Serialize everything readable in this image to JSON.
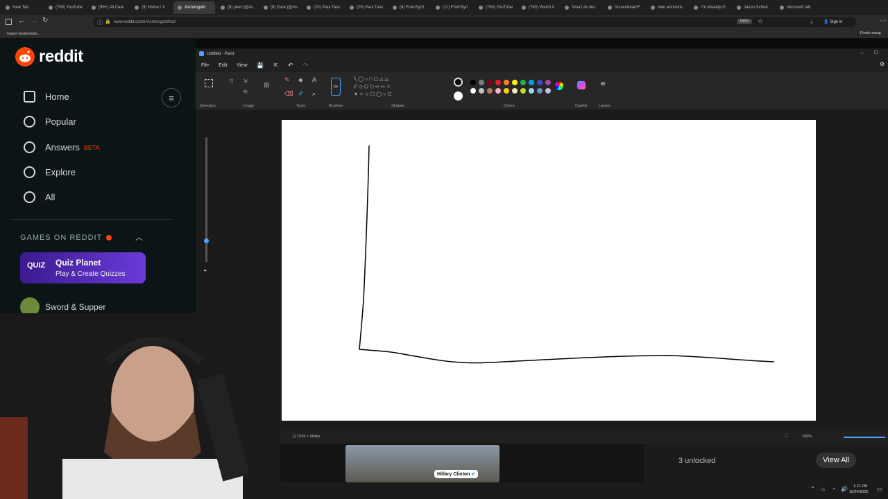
{
  "browser": {
    "tabs": [
      {
        "label": "New Tab"
      },
      {
        "label": "(763) YouTube"
      },
      {
        "label": "(99+) All Cate"
      },
      {
        "label": "(9) Home / X"
      },
      {
        "label": "Asmongold",
        "active": true
      },
      {
        "label": "(8) yeet (@As"
      },
      {
        "label": "(8) Zack (@As"
      },
      {
        "label": "(20) Paul Tass"
      },
      {
        "label": "(20) Paul Tass"
      },
      {
        "label": "(8) FromSynt"
      },
      {
        "label": "(11) FromSyn"
      },
      {
        "label": "(763) YouTube"
      },
      {
        "label": "(763) Watch li"
      },
      {
        "label": "Nina Lim lies"
      },
      {
        "label": "r/LivestreamF"
      },
      {
        "label": "halo announc"
      },
      {
        "label": "I'm Already G"
      },
      {
        "label": "Jason Schrei"
      },
      {
        "label": "microsoft tab"
      }
    ],
    "url": "www.reddit.com/r/Asmongold/hot/",
    "zoom": "180%",
    "sign_in": "Sign in",
    "finish_setup": "Finish setup",
    "bookmarks_label": "Import bookmarks..."
  },
  "reddit": {
    "logo_text": "reddit",
    "nav": [
      {
        "label": "Home",
        "icon": "home-icon"
      },
      {
        "label": "Popular",
        "icon": "popular-icon"
      },
      {
        "label": "Answers",
        "icon": "answers-icon",
        "badge": "BETA"
      },
      {
        "label": "Explore",
        "icon": "explore-icon"
      },
      {
        "label": "All",
        "icon": "all-icon"
      }
    ],
    "games_header": "GAMES ON REDDIT",
    "quiz_title": "Quiz Planet",
    "quiz_subtitle": "Play & Create Quizzes",
    "quiz_badge": "QUIZ",
    "sword_label": "Sword & Supper"
  },
  "paint": {
    "title": "Untitled - Paint",
    "menu": [
      "File",
      "Edit",
      "View"
    ],
    "groups": [
      "Selection",
      "Image",
      "Tools",
      "Brushes",
      "Shapes",
      "Colors",
      "Copilot",
      "Layers"
    ],
    "palette_row1": [
      "#000000",
      "#7f7f7f",
      "#880015",
      "#ed1c24",
      "#ff7f27",
      "#fff200",
      "#22b14c",
      "#00a2e8",
      "#3f48cc",
      "#a349a4"
    ],
    "palette_row2": [
      "#ffffff",
      "#c3c3c3",
      "#b97a57",
      "#ffaec9",
      "#ffc90e",
      "#efe4b0",
      "#b5e61d",
      "#99d9ea",
      "#7092be",
      "#c8bfe7"
    ],
    "canvas_size": "1536 × 864px",
    "zoom": "100%"
  },
  "bottom": {
    "post_author": "Hillary Clinton",
    "unlocked": "3 unlocked",
    "view_all": "View All"
  },
  "taskbar": {
    "time": "1:21 PM",
    "date": "10/24/2025"
  }
}
